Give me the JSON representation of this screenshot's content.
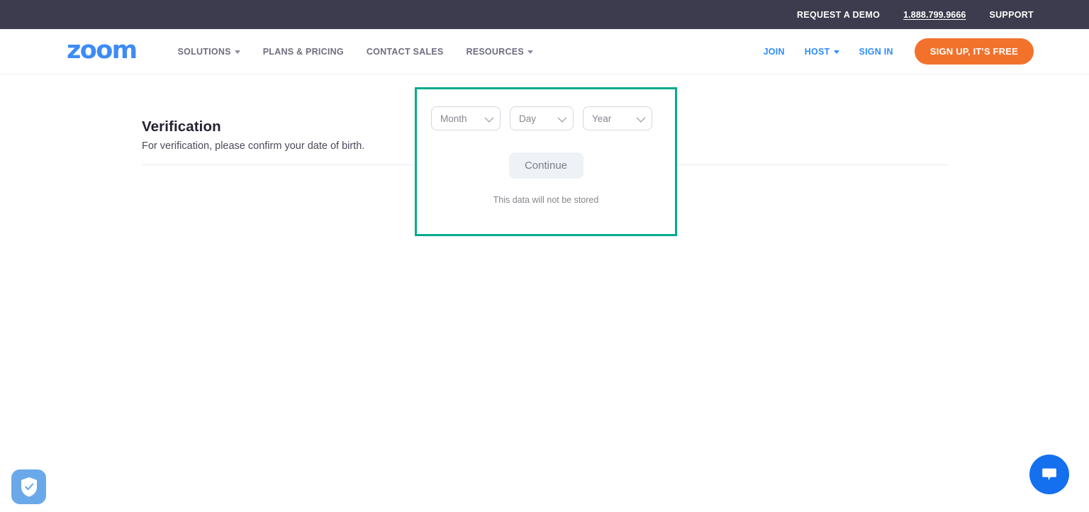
{
  "topbar": {
    "links": [
      {
        "label": "REQUEST A DEMO",
        "underline": false
      },
      {
        "label": "1.888.799.9666",
        "underline": true
      },
      {
        "label": "SUPPORT",
        "underline": false
      }
    ],
    "bg_color": "#3c3c4e"
  },
  "navbar": {
    "logo_text": "zoom",
    "logo_color": "#3d8bf5",
    "left_items": [
      {
        "label": "SOLUTIONS",
        "has_caret": true
      },
      {
        "label": "PLANS & PRICING",
        "has_caret": false
      },
      {
        "label": "CONTACT SALES",
        "has_caret": false
      },
      {
        "label": "RESOURCES",
        "has_caret": true
      }
    ],
    "right_items": [
      {
        "label": "JOIN",
        "has_caret": false
      },
      {
        "label": "HOST",
        "has_caret": true
      },
      {
        "label": "SIGN IN",
        "has_caret": false
      }
    ],
    "signup_label": "SIGN UP, IT'S FREE",
    "signup_color": "#f2722c",
    "link_color": "#2d8cff"
  },
  "page": {
    "title": "Verification",
    "subtitle": "For verification, please confirm your date of birth."
  },
  "dob_form": {
    "highlight_color": "#06ab8d",
    "selects": [
      {
        "name": "month",
        "value": "Month"
      },
      {
        "name": "day",
        "value": "Day"
      },
      {
        "name": "year",
        "value": "Year"
      }
    ],
    "continue_label": "Continue",
    "continue_disabled": "true",
    "note": "This data will not be stored"
  },
  "widgets": {
    "privacy_icon": "shield-check-icon",
    "privacy_bg": "#6aa9e9",
    "chat_icon": "chat-bubble-icon",
    "chat_bg": "#1570ef"
  }
}
